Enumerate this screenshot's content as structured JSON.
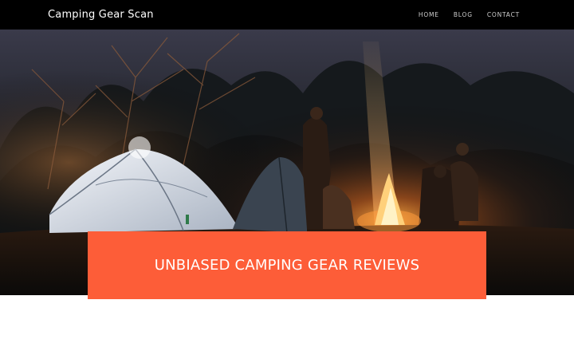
{
  "navbar": {
    "brand": "Camping Gear Scan",
    "links": [
      "HOME",
      "BLOG",
      "CONTACT"
    ]
  },
  "hero": {
    "image": "night campsite with tents and campfire",
    "headline": "UNBIASED CAMPING GEAR REVIEWS"
  },
  "colors": {
    "navbar_bg": "#000000",
    "accent": "#fd5d38",
    "page_bg": "#ffffff"
  }
}
